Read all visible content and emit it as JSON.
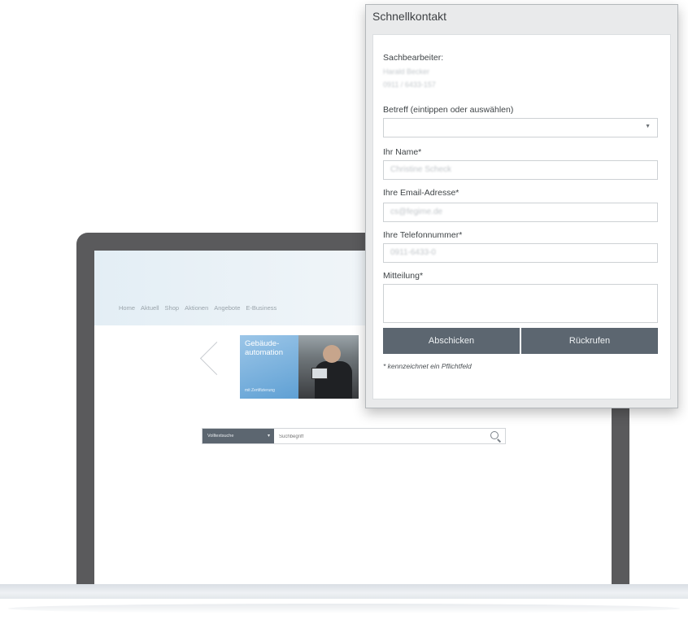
{
  "background_site": {
    "nav": [
      "Home",
      "Aktuell",
      "Shop",
      "Aktionen",
      "Angebote",
      "E-Business"
    ],
    "hero_tile_text": "Gebäude-automation",
    "hero_tile_small": "mit Zertifizierung",
    "search_category": "Volltextsuche",
    "search_placeholder": "Suchbegriff"
  },
  "panel": {
    "title": "Schnellkontakt",
    "agent_label": "Sachbearbeiter:",
    "agent_name": "Harald Becker",
    "agent_phone": "0911 / 6433-157",
    "subject_label": "Betreff (eintippen oder auswählen)",
    "subject_value": "",
    "name_label": "Ihr Name*",
    "name_value": "Christine Scheck",
    "email_label": "Ihre Email-Adresse*",
    "email_value": "cs@fegime.de",
    "phone_label": "Ihre Telefonnummer*",
    "phone_value": "0911-6433-0",
    "message_label": "Mitteilung*",
    "submit_label": "Abschicken",
    "callback_label": "Rückrufen",
    "required_hint": "* kennzeichnet ein Pflichtfeld"
  },
  "colors": {
    "button_bg": "#5c6670",
    "panel_bg": "#e9eaeb",
    "laptop_frame": "#5a5a5c"
  }
}
